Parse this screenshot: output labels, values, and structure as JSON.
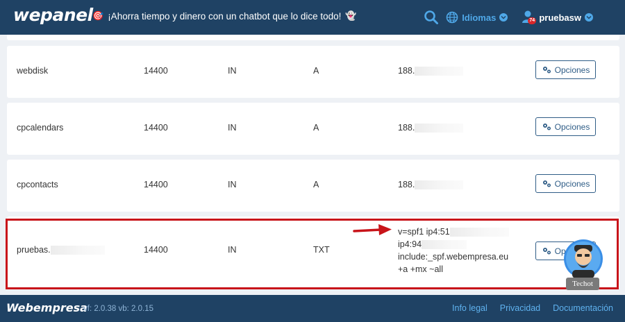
{
  "header": {
    "logo_text": "wepanel",
    "promo_text": "¡Ahorra tiempo y dinero con un chatbot que lo dice todo!",
    "promo_emoji_left": "🎯",
    "promo_emoji_right": "👻",
    "languages_label": "Idiomas",
    "user_name": "pruebasw",
    "notification_count": "74",
    "accent_color": "#4fa8e8",
    "bg_color": "#1f4264"
  },
  "records": [
    {
      "name": "webdisk",
      "ttl": "14400",
      "class": "IN",
      "type": "A",
      "record": "188.",
      "options_label": "Opciones"
    },
    {
      "name": "cpcalendars",
      "ttl": "14400",
      "class": "IN",
      "type": "A",
      "record": "188.",
      "options_label": "Opciones"
    },
    {
      "name": "cpcontacts",
      "ttl": "14400",
      "class": "IN",
      "type": "A",
      "record": "188.",
      "options_label": "Opciones"
    },
    {
      "name": "pruebas.",
      "ttl": "14400",
      "class": "IN",
      "type": "TXT",
      "record_lines": [
        "v=spf1 ip4:51",
        "ip4:94",
        "include:_spf.webempresa.eu",
        "+a +mx ~all"
      ],
      "options_label": "Opciones"
    }
  ],
  "highlight_color": "#c8141a",
  "chatbot": {
    "label": "Techot"
  },
  "footer": {
    "logo_text": "Webempresa",
    "version_text": "vf: 2.0.38 vb: 2.0.15",
    "links": [
      "Info legal",
      "Privacidad",
      "Documentación"
    ]
  }
}
